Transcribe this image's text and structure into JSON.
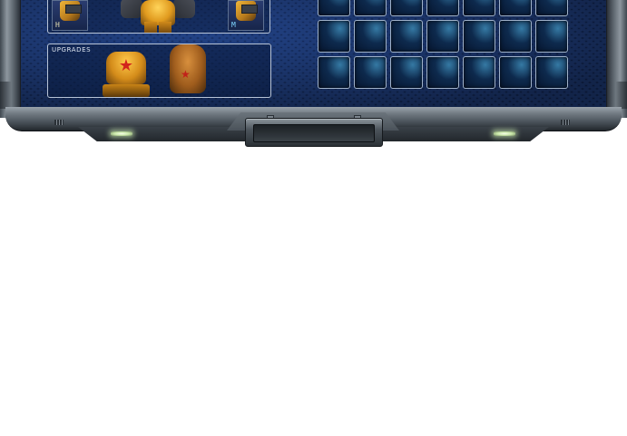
{
  "hero_panel": {
    "thumbnails": [
      {
        "letter": "H",
        "icon": "mech-hunter-icon",
        "letter_color": "#e9e3b5"
      },
      {
        "letter": "M",
        "icon": "mech-missile-icon",
        "letter_color": "#7fd6ff"
      }
    ],
    "hero_portrait": "gold-mech-portrait"
  },
  "upgrades_panel": {
    "label": "UPGRADES",
    "items": [
      {
        "icon": "red-star-mech-icon"
      },
      {
        "icon": "bronze-mech-icon"
      }
    ]
  },
  "inventory": {
    "rows": 3,
    "columns": 7,
    "slot_color": "#081a35",
    "slot_highlight": "#5ac8ff"
  },
  "frame": {
    "indicator_lights": [
      "left-status-light",
      "right-status-light"
    ],
    "center_control": "center-panel-button"
  },
  "colors": {
    "panel_background": "#0f2147",
    "frame_metal": "#6f7880",
    "border_light": "#b7c3d6",
    "mech_gold": "#e09a1e",
    "emblem_red": "#d2241c"
  }
}
